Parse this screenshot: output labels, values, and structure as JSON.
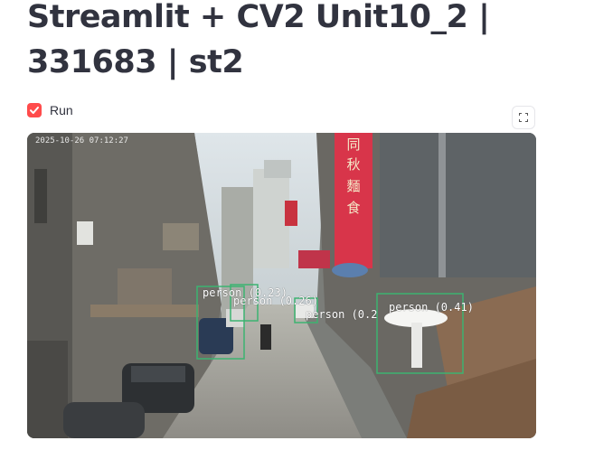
{
  "page": {
    "title": "Streamlit + CV2 Unit10_2 | 331683 | st2"
  },
  "controls": {
    "run_checkbox": {
      "label": "Run",
      "checked": true,
      "color": "#ff4b4b"
    }
  },
  "video": {
    "timestamp": "2025-10-26 07:12:27",
    "detections": [
      {
        "label": "person (0.23)"
      },
      {
        "label": "person (0.26)"
      },
      {
        "label": "person (0.2"
      },
      {
        "label": "person (0.41)"
      }
    ],
    "box_color": "#3cb371",
    "sign_text": "同秋麵食"
  }
}
